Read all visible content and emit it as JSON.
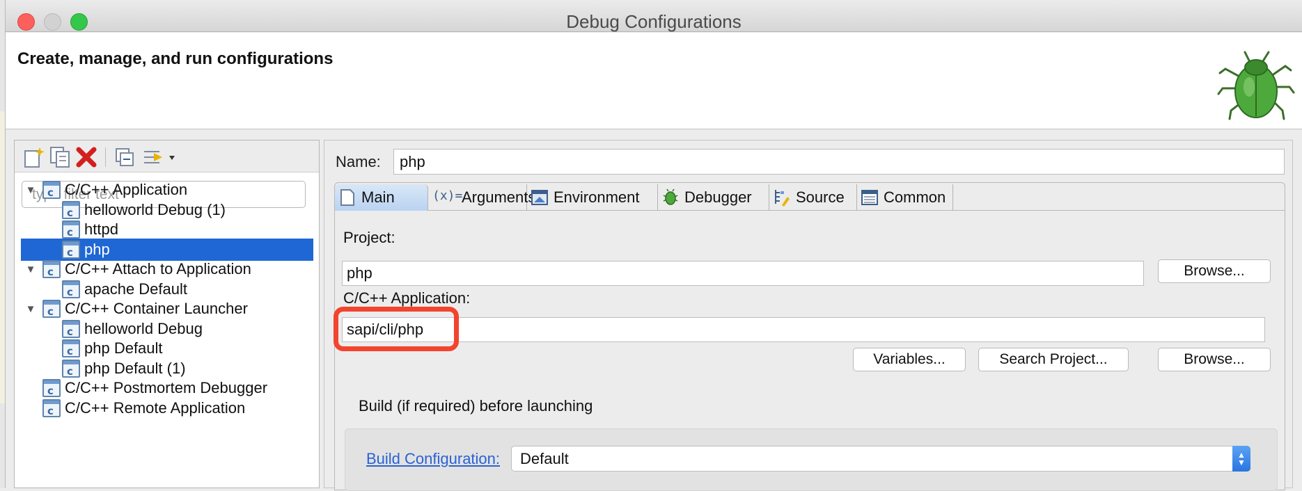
{
  "window": {
    "title": "Debug Configurations"
  },
  "header": {
    "title": "Create, manage, and run configurations"
  },
  "toolbar": {
    "icons": [
      "new-configuration-icon",
      "duplicate-icon",
      "delete-icon",
      "collapse-all-icon",
      "filter-icon"
    ]
  },
  "filter": {
    "placeholder": "type filter text"
  },
  "tree": {
    "items": [
      {
        "label": "C/C++ Application",
        "level": 0,
        "expanded": true
      },
      {
        "label": "helloworld Debug (1)",
        "level": 1
      },
      {
        "label": "httpd",
        "level": 1
      },
      {
        "label": "php",
        "level": 1,
        "selected": true
      },
      {
        "label": "C/C++ Attach to Application",
        "level": 0,
        "expanded": true
      },
      {
        "label": "apache Default",
        "level": 1
      },
      {
        "label": "C/C++ Container Launcher",
        "level": 0,
        "expanded": true
      },
      {
        "label": "helloworld Debug",
        "level": 1
      },
      {
        "label": "php Default",
        "level": 1
      },
      {
        "label": "php Default (1)",
        "level": 1
      },
      {
        "label": "C/C++ Postmortem Debugger",
        "level": 0
      },
      {
        "label": "C/C++ Remote Application",
        "level": 0
      }
    ]
  },
  "config": {
    "name_label": "Name:",
    "name_value": "php",
    "tabs": [
      {
        "label": "Main",
        "icon": "main-tab-icon",
        "active": true
      },
      {
        "label": "Arguments",
        "icon": "arguments-icon"
      },
      {
        "label": "Environment",
        "icon": "environment-icon"
      },
      {
        "label": "Debugger",
        "icon": "debugger-bug-icon"
      },
      {
        "label": "Source",
        "icon": "source-icon"
      },
      {
        "label": "Common",
        "icon": "common-icon"
      }
    ],
    "project_label": "Project:",
    "project_value": "php",
    "browse_label": "Browse...",
    "app_label": "C/C++ Application:",
    "app_value": "sapi/cli/php",
    "variables_label": "Variables...",
    "search_project_label": "Search Project...",
    "browse2_label": "Browse...",
    "build_group_label": "Build (if required) before launching",
    "build_config_link": "Build Configuration:",
    "build_config_value": "Default"
  },
  "colors": {
    "selection": "#1f67d4",
    "highlight": "#f2442e",
    "link": "#2a62d4"
  }
}
